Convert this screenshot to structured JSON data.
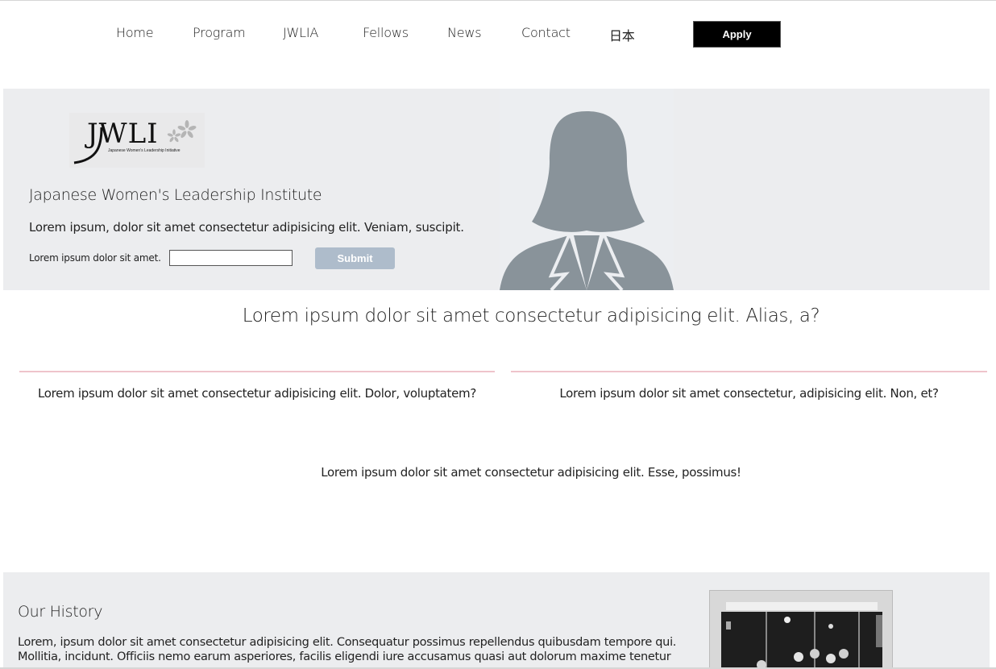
{
  "nav": {
    "items": [
      {
        "label": "Home"
      },
      {
        "label": "Program"
      },
      {
        "label": "JWLIA"
      },
      {
        "label": "Fellows"
      },
      {
        "label": "News"
      },
      {
        "label": "Contact"
      },
      {
        "label": "日本"
      }
    ],
    "apply_label": "Apply"
  },
  "hero": {
    "logo_text": "JWLI",
    "logo_subtext": "Japanese Women's Leadership Initiative",
    "title": "Japanese Women's Leadership Institute",
    "description": "Lorem ipsum, dolor sit amet consectetur adipisicing elit. Veniam, suscipit.",
    "form_label": "Lorem ipsum dolor sit amet.",
    "input_value": "",
    "submit_label": "Submit"
  },
  "intro": {
    "headline": "Lorem ipsum dolor sit amet consectetur adipisicing elit. Alias, a?",
    "left_text": "Lorem ipsum dolor sit amet consectetur adipisicing elit. Dolor, voluptatem?",
    "right_text": "Lorem ipsum dolor sit amet consectetur, adipisicing elit. Non, et?",
    "center_text": "Lorem ipsum dolor sit amet consectetur adipisicing elit. Esse, possimus!"
  },
  "history": {
    "title": "Our History",
    "body": "Lorem, ipsum dolor sit amet consectetur adipisicing elit. Consequatur possimus repellendus quibusdam tempore qui. Mollitia, incidunt. Officiis nemo earum asperiores, facilis eligendi iure accusamus quasi aut dolorum maxime tenetur"
  },
  "colors": {
    "hero_bg": "#ecedef",
    "divider": "#efc4cb",
    "submit_bg": "#aebccb",
    "silhouette": "#89939a",
    "apply_bg": "#000000"
  },
  "icons": {
    "portrait": "person-silhouette-icon",
    "logo_flower": "sakura-flower-icon"
  }
}
